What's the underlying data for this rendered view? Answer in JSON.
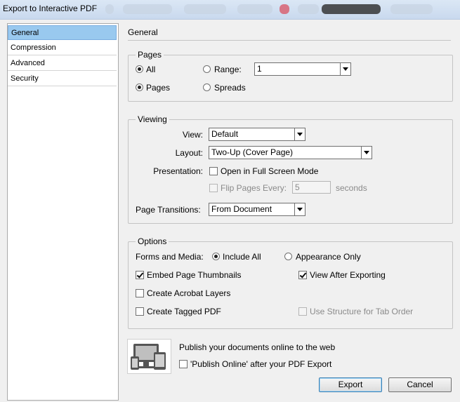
{
  "window": {
    "title": "Export to Interactive PDF"
  },
  "sidebar": {
    "items": [
      {
        "label": "General",
        "selected": true
      },
      {
        "label": "Compression",
        "selected": false
      },
      {
        "label": "Advanced",
        "selected": false
      },
      {
        "label": "Security",
        "selected": false
      }
    ]
  },
  "section_title": "General",
  "pages": {
    "legend": "Pages",
    "all_label": "All",
    "range_label": "Range:",
    "range_value": "1",
    "pages_label": "Pages",
    "spreads_label": "Spreads"
  },
  "viewing": {
    "legend": "Viewing",
    "view_label": "View:",
    "view_value": "Default",
    "layout_label": "Layout:",
    "layout_value": "Two-Up (Cover Page)",
    "presentation_label": "Presentation:",
    "fullscreen_label": "Open in Full Screen Mode",
    "flip_label": "Flip Pages Every:",
    "flip_value": "5",
    "flip_unit": "seconds",
    "transitions_label": "Page Transitions:",
    "transitions_value": "From Document"
  },
  "options": {
    "legend": "Options",
    "forms_label": "Forms and Media:",
    "include_all_label": "Include All",
    "appearance_only_label": "Appearance Only",
    "embed_thumbnails_label": "Embed Page Thumbnails",
    "view_after_label": "View After Exporting",
    "acrobat_layers_label": "Create Acrobat Layers",
    "tagged_pdf_label": "Create Tagged PDF",
    "structure_tab_label": "Use Structure for Tab Order"
  },
  "publish": {
    "text": "Publish your documents online to the web",
    "checkbox_label": "'Publish Online' after your PDF Export"
  },
  "buttons": {
    "export": "Export",
    "cancel": "Cancel"
  }
}
